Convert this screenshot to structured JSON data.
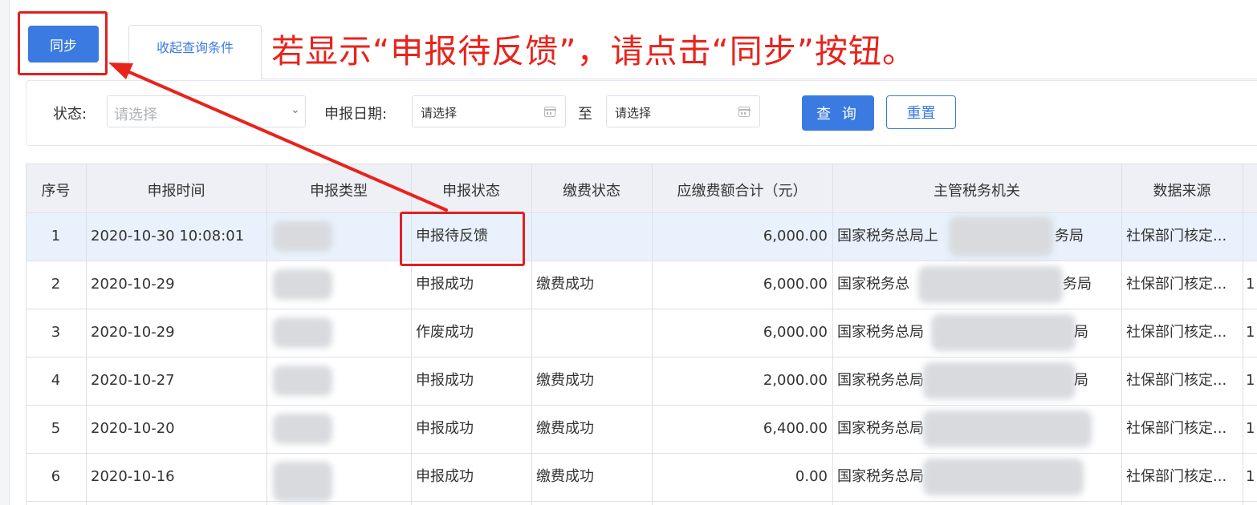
{
  "toolbar": {
    "sync_label": "同步",
    "collapse_tab_label": "收起查询条件"
  },
  "annotation": {
    "text": "若显示“申报待反馈”，请点击“同步”按钮。",
    "color": "#e8231c"
  },
  "filters": {
    "status_label": "状态:",
    "status_placeholder": "请选择",
    "date_label": "申报日期:",
    "date_start_placeholder": "请选择",
    "date_to": "至",
    "date_end_placeholder": "请选择",
    "query_label": "查 询",
    "reset_label": "重置"
  },
  "table": {
    "columns": [
      "序号",
      "申报时间",
      "申报类型",
      "申报状态",
      "缴费状态",
      "应缴费额合计（元）",
      "主管税务机关",
      "数据来源"
    ],
    "rows": [
      {
        "no": "1",
        "time": "2020-10-30 10:08:01",
        "status": "申报待反馈",
        "pay": "",
        "amount": "6,000.00",
        "office": "国家税务总局上",
        "office_tail": "务局",
        "source": "社保部门核定..."
      },
      {
        "no": "2",
        "time": "2020-10-29",
        "status": "申报成功",
        "pay": "缴费成功",
        "amount": "6,000.00",
        "office": "国家税务总",
        "office_tail": "务局",
        "source": "社保部门核定..."
      },
      {
        "no": "3",
        "time": "2020-10-29",
        "status": "作废成功",
        "pay": "",
        "amount": "6,000.00",
        "office": "国家税务总局",
        "office_tail": "局",
        "source": "社保部门核定..."
      },
      {
        "no": "4",
        "time": "2020-10-27",
        "status": "申报成功",
        "pay": "缴费成功",
        "amount": "2,000.00",
        "office": "国家税务总局",
        "office_tail": "局",
        "source": "社保部门核定..."
      },
      {
        "no": "5",
        "time": "2020-10-20",
        "status": "申报成功",
        "pay": "缴费成功",
        "amount": "6,400.00",
        "office": "国家税务总局",
        "office_tail": "",
        "source": "社保部门核定..."
      },
      {
        "no": "6",
        "time": "2020-10-16",
        "status": "申报成功",
        "pay": "缴费成功",
        "amount": "0.00",
        "office": "国家税务总局",
        "office_tail": "",
        "source": "社保部门核定..."
      }
    ],
    "overflow_char": "1"
  },
  "colors": {
    "primary": "#3b7ae0",
    "highlight_red": "#e02020",
    "selected_row": "#e9f2fc",
    "header_bg": "#eef0f5"
  },
  "icons": {
    "status_dropdown": "chevron-down-icon",
    "date_picker": "calendar-icon"
  }
}
